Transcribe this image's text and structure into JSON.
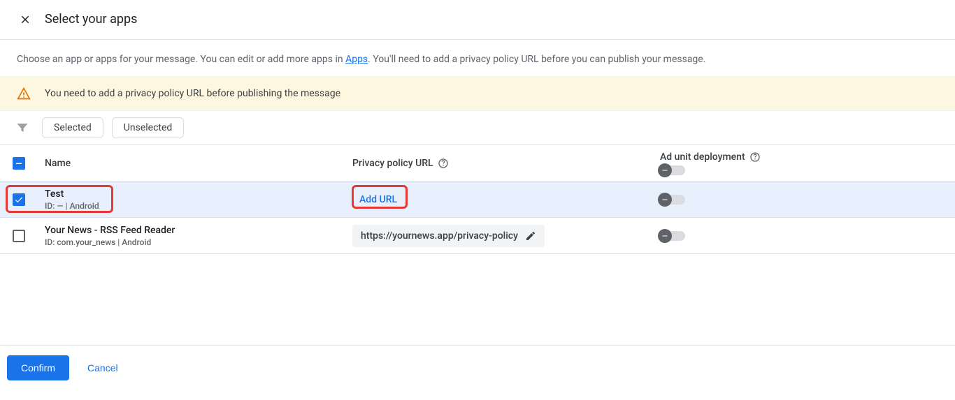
{
  "header": {
    "title": "Select your apps"
  },
  "intro": {
    "pre": "Choose an app or apps for your message. You can edit or add more apps in ",
    "link": "Apps",
    "post": ". You'll need to add a privacy policy URL before you can publish your message."
  },
  "banner": {
    "text": "You need to add a privacy policy URL before publishing the message"
  },
  "filters": {
    "selected": "Selected",
    "unselected": "Unselected"
  },
  "columns": {
    "name": "Name",
    "policy": "Privacy policy URL",
    "deploy": "Ad unit deployment"
  },
  "rows": [
    {
      "checked": true,
      "name": "Test",
      "sub": "ID: — | Android",
      "policy_type": "add",
      "add_label": "Add URL"
    },
    {
      "checked": false,
      "name": "Your News - RSS Feed Reader",
      "sub": "ID: com.your_news | Android",
      "policy_type": "url",
      "url": "https://yournews.app/privacy-policy"
    }
  ],
  "footer": {
    "confirm": "Confirm",
    "cancel": "Cancel"
  }
}
